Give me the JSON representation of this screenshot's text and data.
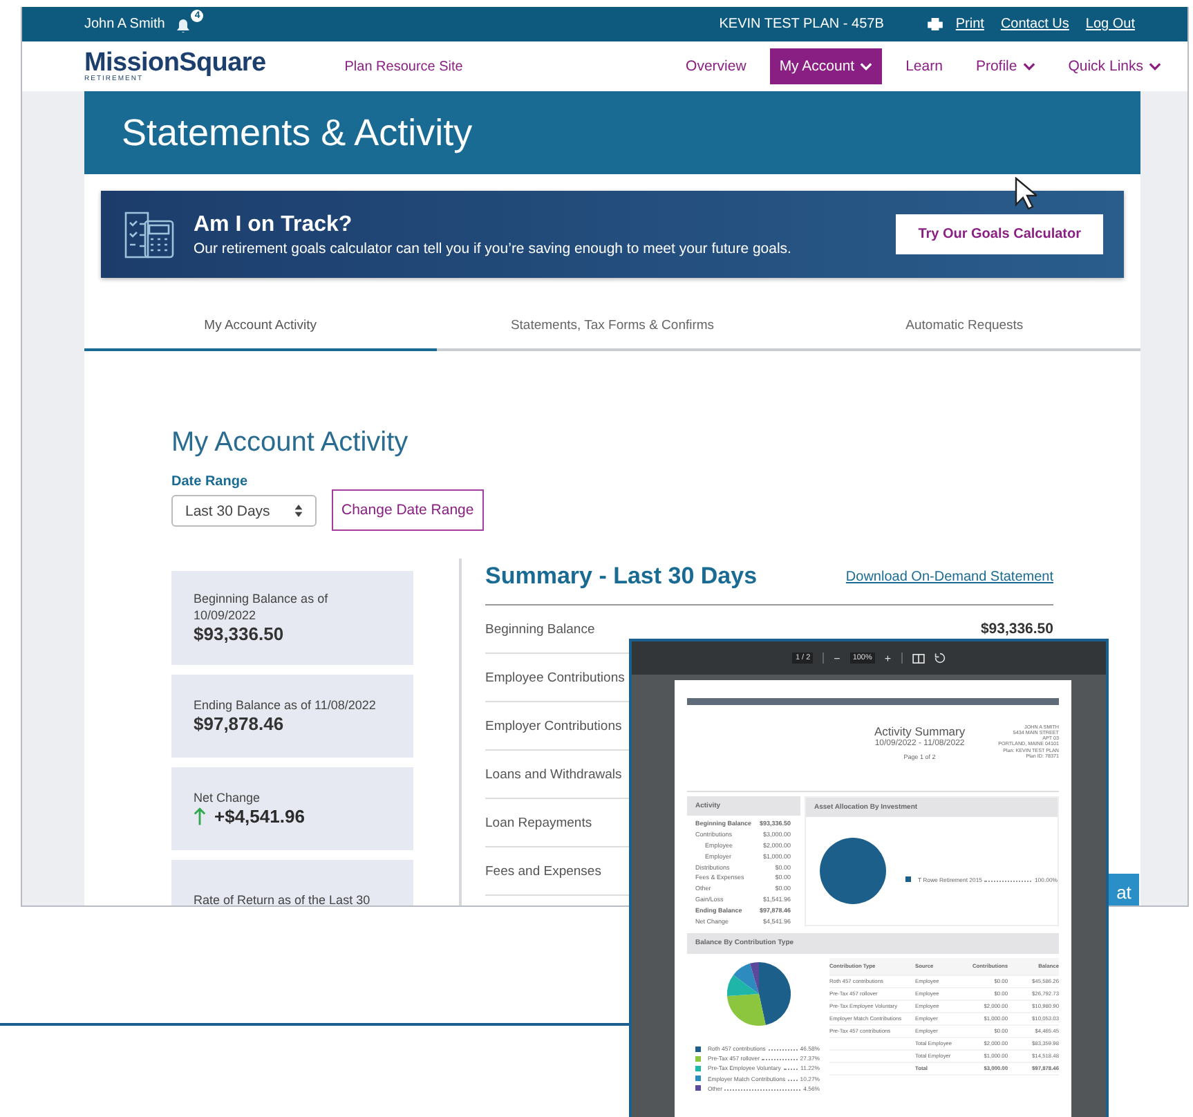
{
  "top_bar": {
    "user": "John A Smith",
    "notifications": "4",
    "plan": "KEVIN TEST PLAN - 457B",
    "links": [
      "Print",
      "Contact Us",
      "Log Out"
    ]
  },
  "nav": {
    "logo": "MissionSquare",
    "logo_sub": "RETIREMENT",
    "site_link": "Plan Resource Site",
    "items": [
      {
        "label": "Overview",
        "selected": false,
        "dropdown": false
      },
      {
        "label": "My Account",
        "selected": true,
        "dropdown": true
      },
      {
        "label": "Learn",
        "selected": false,
        "dropdown": false
      },
      {
        "label": "Profile",
        "selected": false,
        "dropdown": true
      },
      {
        "label": "Quick Links",
        "selected": false,
        "dropdown": true
      }
    ]
  },
  "page_title": "Statements & Activity",
  "banner": {
    "title": "Am I on Track?",
    "text": "Our retirement goals calculator can tell you if you’re saving enough to meet your future goals.",
    "button": "Try Our Goals Calculator"
  },
  "tabs": [
    {
      "label": "My Account Activity",
      "selected": true
    },
    {
      "label": "Statements, Tax Forms & Confirms",
      "selected": false
    },
    {
      "label": "Automatic Requests",
      "selected": false
    }
  ],
  "activity": {
    "heading": "My Account Activity",
    "date_range_label": "Date Range",
    "date_range_value": "Last 30 Days",
    "change_button": "Change Date Range",
    "cards": [
      {
        "label": "Beginning Balance as of 10/09/2022",
        "value": "$93,336.50",
        "kind": "balance"
      },
      {
        "label": "Ending Balance as of 11/08/2022",
        "value": "$97,878.46",
        "kind": "balance"
      },
      {
        "label": "Net Change",
        "value": "+$4,541.96",
        "kind": "gain"
      },
      {
        "label": "Rate of Return as of the Last 30",
        "kind": "balance"
      }
    ],
    "summary_title": "Summary - Last 30 Days",
    "download_link": "Download On-Demand Statement",
    "summary_rows": [
      {
        "label": "Beginning Balance",
        "value": "$93,336.50"
      },
      {
        "label": "Employee Contributions"
      },
      {
        "label": "Employer Contributions"
      },
      {
        "label": "Loans and Withdrawals"
      },
      {
        "label": "Loan Repayments"
      },
      {
        "label": "Fees and Expenses"
      }
    ],
    "chat_button": "at"
  },
  "pdf_viewer": {
    "page_counter": "1 / 2",
    "zoom": "100%",
    "minus": "−",
    "plus": "+",
    "document": {
      "title": "Activity Summary",
      "dates": "10/09/2022 - 11/08/2022",
      "page": "Page 1 of 2",
      "address": [
        "JOHN A SMITH",
        "5434 MAIN STREET",
        "APT 03",
        "PORTLAND, MAINE 04101",
        "Plan: KEVIN TEST PLAN",
        "Plan ID: 78371"
      ],
      "activity_title": "Activity",
      "activity_rows": [
        {
          "label": "Beginning Balance",
          "value": "$93,336.50",
          "kind": "bold"
        },
        {
          "label": "Contributions",
          "value": "$3,000.00",
          "kind": "plain"
        },
        {
          "label": "Employee",
          "value": "$2,000.00",
          "kind": "indent"
        },
        {
          "label": "Employer",
          "value": "$1,000.00",
          "kind": "indent"
        },
        {
          "label": "Distributions",
          "value": "$0.00",
          "kind": "plain"
        },
        {
          "label": "Fees & Expenses",
          "value": "$0.00",
          "kind": "plain"
        },
        {
          "label": "Other",
          "value": "$0.00",
          "kind": "plain"
        },
        {
          "label": "Gain/Loss",
          "value": "$1,541.96",
          "kind": "plain"
        },
        {
          "label": "Ending Balance",
          "value": "$97,878.46",
          "kind": "bold"
        },
        {
          "label": "Net Change",
          "value": "$4,541.96",
          "kind": "plain"
        }
      ],
      "allocation_title": "Asset Allocation By Investment",
      "allocation_chart": {
        "chart_data": {
          "type": "pie",
          "categories": [
            "T Rowe Retirement 2015"
          ],
          "values": [
            100
          ]
        }
      },
      "allocation_legend": [
        {
          "percent": "100.00%",
          "color": "#1b5f8a"
        }
      ],
      "balance_title": "Balance By Contribution Type",
      "balance_chart": {
        "chart_data": {
          "type": "pie",
          "categories": [
            "Roth 457 contributions",
            "Pre-Tax 457 rollover",
            "Pre-Tax Employee Voluntary",
            "Employer Match Contributions",
            "Other"
          ],
          "values": [
            46.58,
            27.37,
            11.22,
            10.27,
            4.56
          ]
        }
      },
      "balance_legend": [
        {
          "percent": "46.58%",
          "color": "#1b5f8a"
        },
        {
          "percent": "27.37%",
          "color": "#8cc63f"
        },
        {
          "percent": "11.22%",
          "color": "#1fb5a8"
        },
        {
          "percent": "10.27%",
          "color": "#2e8bc0"
        },
        {
          "percent": "4.56%",
          "color": "#5b4a9b"
        }
      ],
      "table_columns": [
        "Contribution Type",
        "Source",
        "Contributions",
        "Balance"
      ],
      "table_rows": [
        {
          "type": "Roth 457 contributions",
          "source": "Employee",
          "contributions": "$0.00",
          "balance": "$45,586.26"
        },
        {
          "type": "Pre-Tax 457 rollover",
          "source": "Employee",
          "contributions": "$0.00",
          "balance": "$26,792.73"
        },
        {
          "type": "Pre-Tax Employee Voluntary",
          "source": "Employee",
          "contributions": "$2,000.00",
          "balance": "$10,980.90"
        },
        {
          "type": "Employer Match Contributions",
          "source": "Employer",
          "contributions": "$1,000.00",
          "balance": "$10,053.03"
        },
        {
          "type": "Pre-Tax 457 contributions",
          "source": "Employer",
          "contributions": "$0.00",
          "balance": "$4,465.45"
        }
      ],
      "table_totals": [
        {
          "label": "Total Employee",
          "contributions": "$2,000.00",
          "balance": "$83,359.98",
          "kind": "subtotal"
        },
        {
          "label": "Total Employer",
          "contributions": "$1,000.00",
          "balance": "$14,518.48",
          "kind": "subtotal"
        },
        {
          "label": "Total",
          "contributions": "$3,000.00",
          "balance": "$97,878.46",
          "kind": "total"
        }
      ]
    }
  }
}
